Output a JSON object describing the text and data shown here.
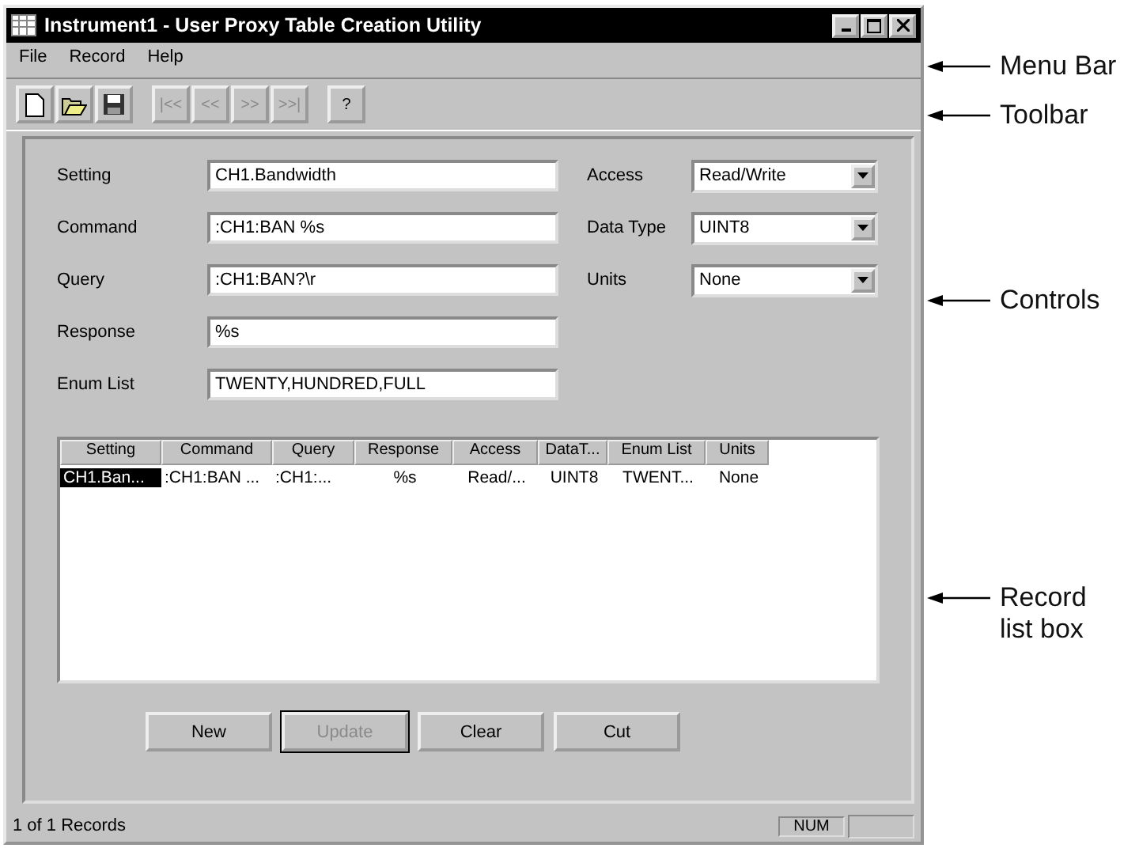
{
  "window": {
    "title": "Instrument1 - User Proxy Table Creation Utility"
  },
  "menu": [
    {
      "label": "File"
    },
    {
      "label": "Record"
    },
    {
      "label": "Help"
    }
  ],
  "toolbar": [
    {
      "kind": "new",
      "disabled": false
    },
    {
      "kind": "open",
      "disabled": false
    },
    {
      "kind": "save",
      "disabled": false
    },
    {
      "kind": "nav",
      "label": "|<<",
      "disabled": true
    },
    {
      "kind": "nav",
      "label": "<<",
      "disabled": true
    },
    {
      "kind": "nav",
      "label": ">>",
      "disabled": true
    },
    {
      "kind": "nav",
      "label": ">>|",
      "disabled": true
    },
    {
      "kind": "help",
      "label": "?",
      "disabled": false
    }
  ],
  "form": {
    "fields": [
      {
        "label": "Setting",
        "value": "CH1.Bandwidth"
      },
      {
        "label": "Command",
        "value": ":CH1:BAN %s"
      },
      {
        "label": "Query",
        "value": ":CH1:BAN?\\r"
      },
      {
        "label": "Response",
        "value": "%s"
      },
      {
        "label": "Enum List",
        "value": "TWENTY,HUNDRED,FULL"
      }
    ],
    "dropdowns": [
      {
        "label": "Access",
        "value": "Read/Write"
      },
      {
        "label": "Data Type",
        "value": "UINT8"
      },
      {
        "label": "Units",
        "value": "None"
      }
    ]
  },
  "table": {
    "columns": [
      "Setting",
      "Command",
      "Query",
      "Response",
      "Access",
      "DataT...",
      "Enum List",
      "Units"
    ],
    "rows": [
      {
        "selected": true,
        "cells": [
          "CH1.Ban...",
          ":CH1:BAN ...",
          ":CH1:...",
          "%s",
          "Read/...",
          "UINT8",
          "TWENT...",
          "None"
        ]
      }
    ]
  },
  "buttons": [
    {
      "label": "New",
      "disabled": false
    },
    {
      "label": "Update",
      "disabled": true
    },
    {
      "label": "Clear",
      "disabled": false
    },
    {
      "label": "Cut",
      "disabled": false
    }
  ],
  "status_bar": {
    "text": "1 of 1 Records",
    "indicator": "NUM"
  },
  "callouts": [
    {
      "label": "Menu Bar"
    },
    {
      "label": "Toolbar"
    },
    {
      "label": "Controls"
    },
    {
      "label": "Record list box"
    }
  ]
}
